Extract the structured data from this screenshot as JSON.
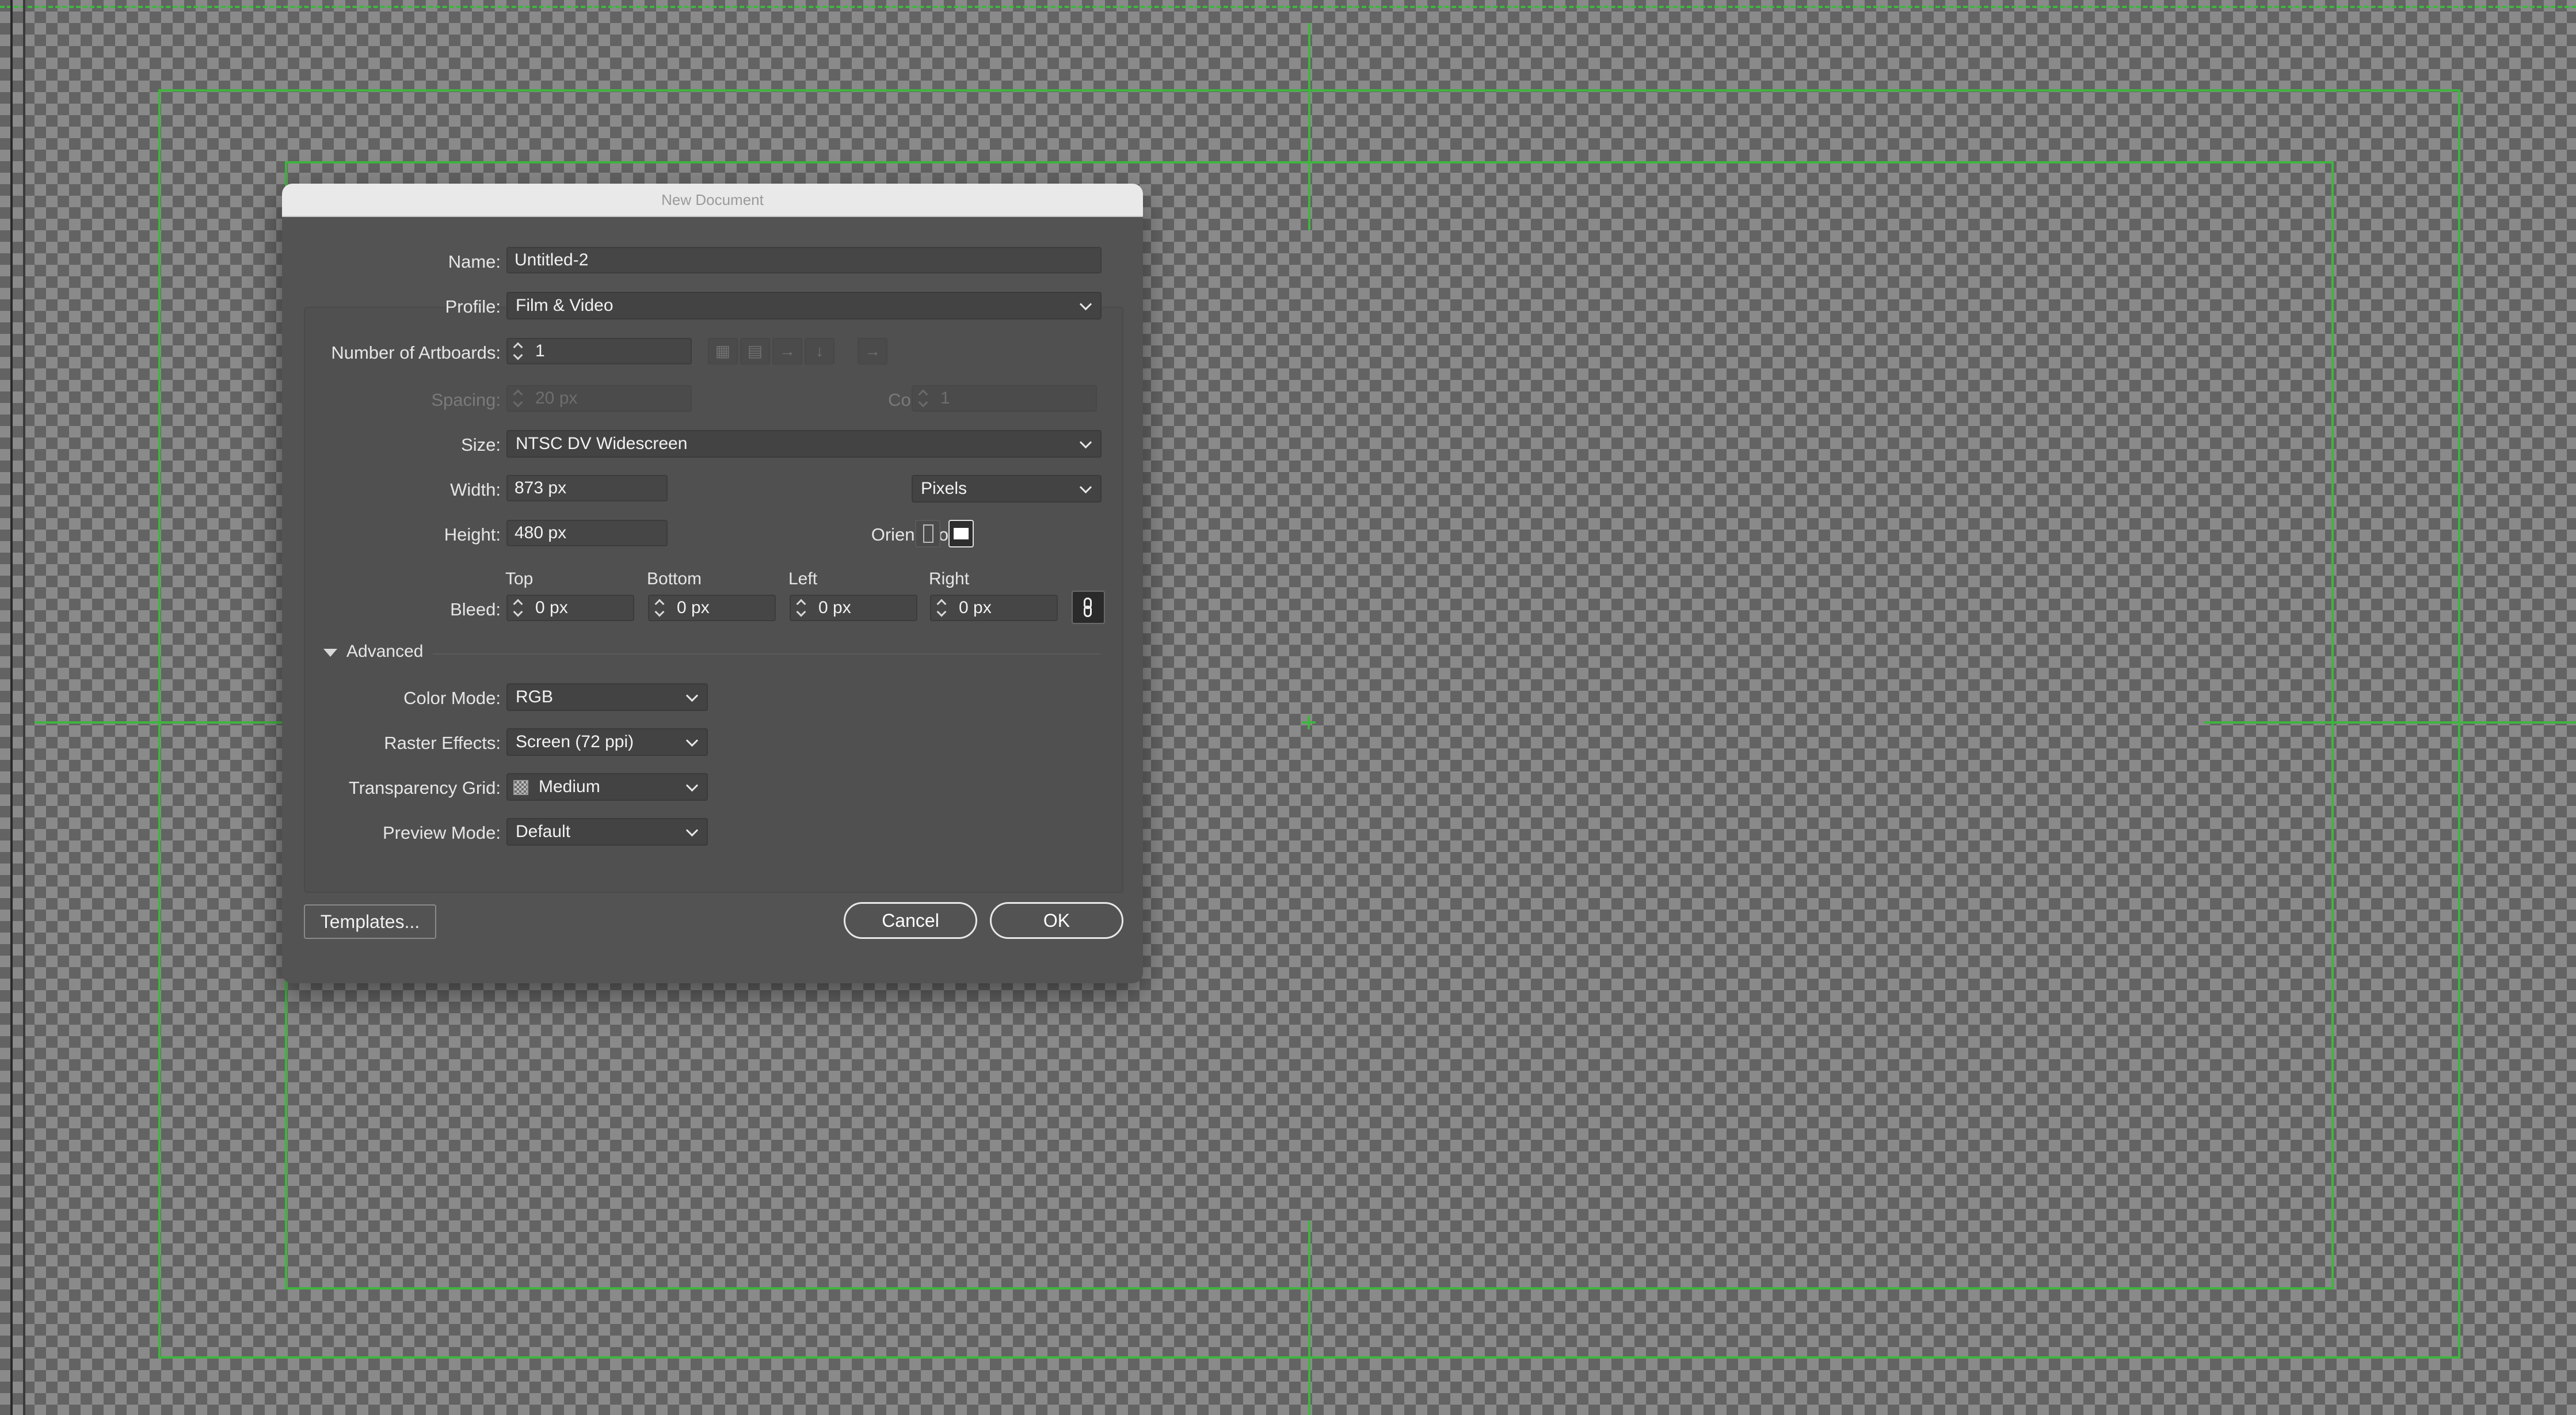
{
  "dialog": {
    "title": "New Document",
    "name": {
      "label": "Name:",
      "value": "Untitled-2"
    },
    "profile": {
      "label": "Profile:",
      "value": "Film & Video"
    },
    "artboards": {
      "label": "Number of Artboards:",
      "value": "1"
    },
    "spacing": {
      "label": "Spacing:",
      "value": "20 px"
    },
    "columns": {
      "label": "Columns:",
      "value": "1"
    },
    "size": {
      "label": "Size:",
      "value": "NTSC DV Widescreen"
    },
    "width": {
      "label": "Width:",
      "value": "873 px"
    },
    "units": {
      "label": "Units:",
      "value": "Pixels"
    },
    "height": {
      "label": "Height:",
      "value": "480 px"
    },
    "orientation": {
      "label": "Orientation:",
      "selected": "landscape"
    },
    "bleed": {
      "label": "Bleed:",
      "top_label": "Top",
      "top": "0 px",
      "bottom_label": "Bottom",
      "bottom": "0 px",
      "left_label": "Left",
      "left": "0 px",
      "right_label": "Right",
      "right": "0 px"
    },
    "advanced": {
      "label": "Advanced",
      "color_mode": {
        "label": "Color Mode:",
        "value": "RGB"
      },
      "raster_effects": {
        "label": "Raster Effects:",
        "value": "Screen (72 ppi)"
      },
      "transparency_grid": {
        "label": "Transparency Grid:",
        "value": "Medium"
      },
      "preview_mode": {
        "label": "Preview Mode:",
        "value": "Default"
      }
    },
    "buttons": {
      "templates": "Templates...",
      "cancel": "Cancel",
      "ok": "OK"
    }
  },
  "colors": {
    "guide": "#3fb53f",
    "dialog_bg": "#535353",
    "titlebar": "#e9e9e9"
  }
}
